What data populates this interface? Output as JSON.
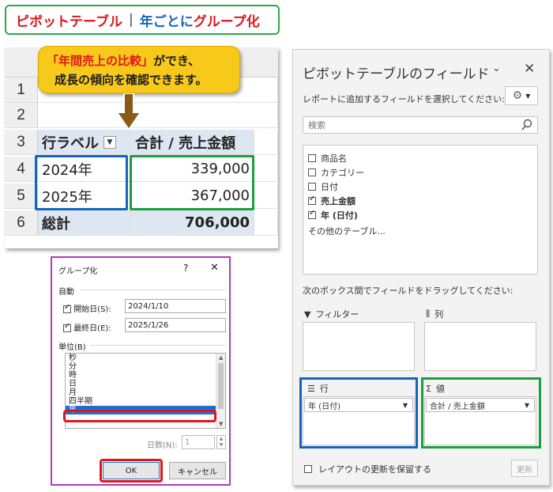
{
  "title": {
    "part1": "ピボットテーブル",
    "separator": "|",
    "part2": "年ごと",
    "part3": "に",
    "part4": "グループ化"
  },
  "callout": {
    "quote": "「年間売上の比較」",
    "line1_rest": "ができ、",
    "line2": "成長の傾向を確認できます。"
  },
  "sheet": {
    "row_numbers": [
      "1",
      "2",
      "3",
      "4",
      "5",
      "6"
    ],
    "header": {
      "label": "行ラベル",
      "value": "合計 / 売上金額"
    },
    "rows": [
      {
        "label": "2024年",
        "value": "339,000"
      },
      {
        "label": "2025年",
        "value": "367,000"
      }
    ],
    "total": {
      "label": "総計",
      "value": "706,000"
    }
  },
  "group_dialog": {
    "title": "グループ化",
    "help": "?",
    "close": "✕",
    "auto_section": "自動",
    "start_label": "開始日(S):",
    "start_value": "2024/1/10",
    "end_label": "最終日(E):",
    "end_value": "2025/1/26",
    "unit_section": "単位(B)",
    "units": [
      "秒",
      "分",
      "時",
      "日",
      "月",
      "四半期",
      "年"
    ],
    "selected_unit": "年",
    "days_label": "日数(N):",
    "days_value": "1",
    "ok_label": "OK",
    "cancel_label": "キャンセル"
  },
  "field_panel": {
    "title": "ピボットテーブルのフィールド",
    "subtitle": "レポートに追加するフィールドを選択してください:",
    "search_placeholder": "検索",
    "fields": [
      {
        "name": "商品名",
        "checked": false
      },
      {
        "name": "カテゴリー",
        "checked": false
      },
      {
        "name": "日付",
        "checked": false
      },
      {
        "name": "売上金額",
        "checked": true
      },
      {
        "name": "年 (日付)",
        "checked": true
      }
    ],
    "more_tables": "その他のテーブル...",
    "instructions": "次のボックス間でフィールドをドラッグしてください:",
    "areas": {
      "filter": "フィルター",
      "columns": "列",
      "rows": "行",
      "values": "値"
    },
    "rows_item": "年 (日付)",
    "values_item": "合計 / 売上金額",
    "defer_label": "レイアウトの更新を保留する",
    "update_label": "更新"
  },
  "colors": {
    "highlight_blue": "#1565c0",
    "highlight_green": "#1a9e3e",
    "highlight_red": "#e0161c",
    "callout_yellow": "#f7c91b",
    "dialog_border": "#b13bb8"
  }
}
